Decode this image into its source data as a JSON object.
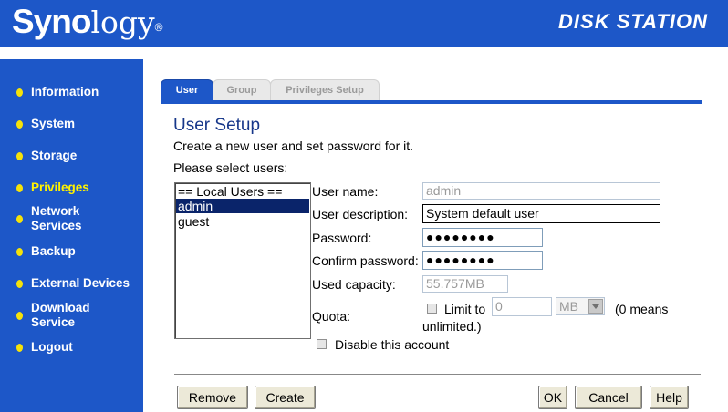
{
  "header": {
    "brand_main": "Syno",
    "brand_thin": "logy",
    "brand_mark": "®",
    "product": "DISK STATION"
  },
  "sidebar": {
    "items": [
      {
        "label": "Information",
        "lines": [
          "Information"
        ]
      },
      {
        "label": "System",
        "lines": [
          "System"
        ]
      },
      {
        "label": "Storage",
        "lines": [
          "Storage"
        ]
      },
      {
        "label": "Privileges",
        "lines": [
          "Privileges"
        ],
        "active": true
      },
      {
        "label": "Network Services",
        "lines": [
          "Network",
          "Services"
        ]
      },
      {
        "label": "Backup",
        "lines": [
          "Backup"
        ]
      },
      {
        "label": "External Devices",
        "lines": [
          "External Devices"
        ]
      },
      {
        "label": "Download Service",
        "lines": [
          "Download",
          "Service"
        ]
      },
      {
        "label": "Logout",
        "lines": [
          "Logout"
        ]
      }
    ]
  },
  "tabs": [
    {
      "label": "User",
      "active": true
    },
    {
      "label": "Group",
      "active": false
    },
    {
      "label": "Privileges Setup",
      "active": false
    }
  ],
  "content": {
    "title": "User Setup",
    "description": "Create a new user and set password for it.",
    "select_prompt": "Please select users:",
    "user_list": [
      "== Local Users ==",
      "admin",
      "guest"
    ],
    "selected_user": "admin"
  },
  "form": {
    "username_label": "User name:",
    "username_value": "admin",
    "description_label": "User description:",
    "description_value": "System default user",
    "password_label": "Password:",
    "password_value": "●●●●●●●●",
    "confirm_label": "Confirm password:",
    "confirm_value": "●●●●●●●●",
    "capacity_label": "Used capacity:",
    "capacity_value": "55.757MB",
    "quota_label": "Quota:",
    "limit_label": "Limit to",
    "quota_value": "0",
    "quota_unit": "MB",
    "quota_note_1": "(0 means",
    "quota_note_2": "unlimited.)",
    "disable_label": "Disable this account"
  },
  "buttons": {
    "remove": "Remove",
    "create": "Create",
    "ok": "OK",
    "cancel": "Cancel",
    "help": "Help"
  },
  "colors": {
    "brand_blue": "#1d57c8",
    "active_nav": "#fff200",
    "bullet": "#f5e20a",
    "selection": "#0a246a"
  }
}
